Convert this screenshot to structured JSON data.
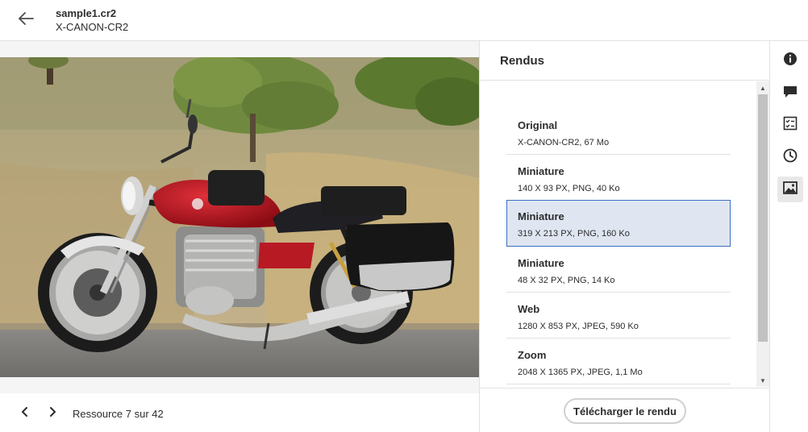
{
  "header": {
    "back_icon": "arrow-left-icon",
    "file_name": "sample1.cr2",
    "file_type": "X-CANON-CR2"
  },
  "viewer": {
    "image_subject": "",
    "footer": {
      "prev_icon": "chevron-left-icon",
      "next_icon": "chevron-right-icon",
      "resource_label": "Ressource 7 sur 42"
    }
  },
  "panel": {
    "title": "Rendus",
    "renditions": [
      {
        "name": "Original",
        "meta": "X-CANON-CR2, 67  Mo",
        "selected": false
      },
      {
        "name": "Miniature",
        "meta": "140 X 93 PX, PNG, 40  Ko",
        "selected": false
      },
      {
        "name": "Miniature",
        "meta": "319 X 213 PX, PNG, 160  Ko",
        "selected": true
      },
      {
        "name": "Miniature",
        "meta": "48 X 32 PX, PNG, 14  Ko",
        "selected": false
      },
      {
        "name": "Web",
        "meta": "1280 X 853 PX, JPEG, 590  Ko",
        "selected": false
      },
      {
        "name": "Zoom",
        "meta": "2048 X 1365 PX, JPEG, 1,1  Mo",
        "selected": false
      }
    ],
    "download_label": "Télécharger le rendu"
  },
  "rail": {
    "items": [
      {
        "icon": "info-icon",
        "active": false
      },
      {
        "icon": "comment-icon",
        "active": false
      },
      {
        "icon": "checklist-icon",
        "active": false
      },
      {
        "icon": "clock-icon",
        "active": false
      },
      {
        "icon": "image-icon",
        "active": true
      }
    ]
  },
  "colors": {
    "selected_bg": "#dfe6f1",
    "selected_border": "#3a6fc4",
    "motorcycle_red": "#b0121c"
  }
}
